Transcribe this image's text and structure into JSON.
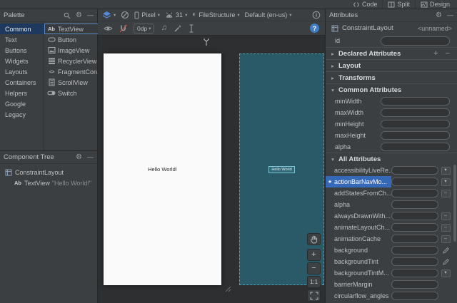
{
  "topbar": {
    "tabs": [
      {
        "label": "Code"
      },
      {
        "label": "Split"
      },
      {
        "label": "Design"
      }
    ]
  },
  "icons": {
    "ab_badge": "Ab",
    "gear": "⚙",
    "minimize": "—",
    "dropdown_arrow": "▾",
    "collapsed_arrow": "▸",
    "expanded_arrow": "▾",
    "notes": "♫",
    "theme_glyph": "◐",
    "help": "?",
    "add": "+",
    "remove": "−",
    "zoom_in": "+",
    "zoom_out": "−",
    "toggle_dash": "–",
    "star": "★",
    "brackets": "<>"
  },
  "palette": {
    "title": "Palette",
    "categories": [
      {
        "label": "Common",
        "selected": true
      },
      {
        "label": "Text"
      },
      {
        "label": "Buttons"
      },
      {
        "label": "Widgets"
      },
      {
        "label": "Layouts"
      },
      {
        "label": "Containers"
      },
      {
        "label": "Helpers"
      },
      {
        "label": "Google"
      },
      {
        "label": "Legacy"
      }
    ],
    "components": [
      {
        "label": "TextView",
        "selected": true
      },
      {
        "label": "Button"
      },
      {
        "label": "ImageView"
      },
      {
        "label": "RecyclerView"
      },
      {
        "label": "FragmentCon..."
      },
      {
        "label": "ScrollView"
      },
      {
        "label": "Switch"
      }
    ]
  },
  "component_tree": {
    "title": "Component Tree",
    "root_label": "ConstraintLayout",
    "child_label": "TextView",
    "child_value": "\"Hello World!\""
  },
  "toolbar": {
    "device": "Pixel",
    "api_level": "31",
    "theme_name": "FileStructure",
    "locale": "Default (en-us)",
    "default_margin": "0dp"
  },
  "canvas": {
    "design_label": "Hello World!",
    "blueprint_label": "Hello World",
    "zoom_actual": "1:1"
  },
  "attributes": {
    "title": "Attributes",
    "component_type": "ConstraintLayout",
    "component_name": "<unnamed>",
    "id_label": "id",
    "id_value": "",
    "sections": {
      "declared": "Declared Attributes",
      "layout": "Layout",
      "transforms": "Transforms",
      "common": "Common Attributes",
      "all": "All Attributes"
    },
    "common_rows": [
      {
        "name": "minWidth",
        "value": ""
      },
      {
        "name": "maxWidth",
        "value": ""
      },
      {
        "name": "minHeight",
        "value": ""
      },
      {
        "name": "maxHeight",
        "value": ""
      },
      {
        "name": "alpha",
        "value": ""
      }
    ],
    "all_rows": [
      {
        "name": "accessibilityLiveRe...",
        "control": "dropdown",
        "value": ""
      },
      {
        "name": "actionBarNavMo...",
        "control": "dropdown",
        "value": "",
        "selected": true
      },
      {
        "name": "addStatesFromCh...",
        "control": "toggle",
        "value": ""
      },
      {
        "name": "alpha",
        "control": "text",
        "value": ""
      },
      {
        "name": "alwaysDrawnWith...",
        "control": "toggle",
        "value": ""
      },
      {
        "name": "animateLayoutCh...",
        "control": "toggle",
        "value": ""
      },
      {
        "name": "animationCache",
        "control": "toggle",
        "value": ""
      },
      {
        "name": "background",
        "control": "pencil",
        "value": ""
      },
      {
        "name": "backgroundTint",
        "control": "pencil",
        "value": ""
      },
      {
        "name": "backgroundTintM...",
        "control": "dropdown",
        "value": ""
      },
      {
        "name": "barrierMargin",
        "control": "text",
        "value": ""
      },
      {
        "name": "circularflow_angles",
        "control": "text",
        "value": ""
      }
    ]
  },
  "colors": {
    "panel_bg": "#3c3f41",
    "canvas_bg": "#2d2f30",
    "selection_navy": "#1d3a5e",
    "selection_blue": "#3668b8",
    "blueprint_teal": "#2a5a68",
    "accent_blue": "#5789d6"
  }
}
